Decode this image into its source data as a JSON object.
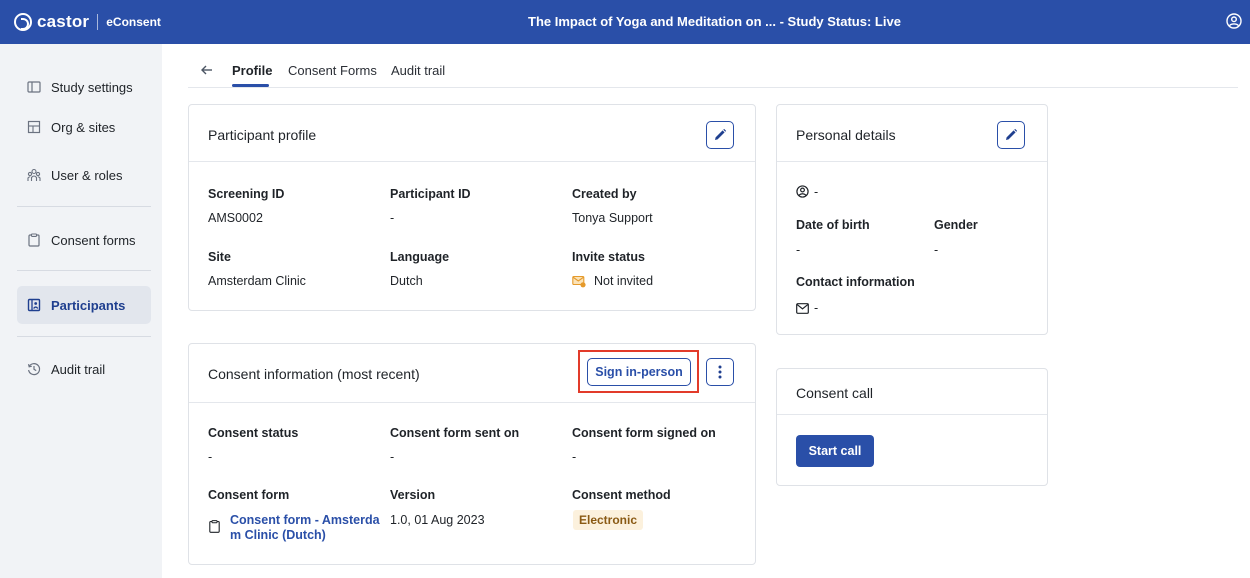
{
  "app": {
    "brand": "castor",
    "product": "eConsent",
    "title": "The Impact of Yoga and Meditation on ...  - Study Status: Live"
  },
  "sidebar": {
    "items": [
      {
        "label": "Study settings",
        "icon": "book-icon"
      },
      {
        "label": "Org & sites",
        "icon": "building-icon"
      },
      {
        "label": "User & roles",
        "icon": "users-icon"
      },
      {
        "label": "Consent forms",
        "icon": "clipboard-icon"
      },
      {
        "label": "Participants",
        "icon": "participants-icon",
        "active": true
      },
      {
        "label": "Audit trail",
        "icon": "history-icon"
      }
    ]
  },
  "tabs": [
    {
      "label": "Profile",
      "active": true
    },
    {
      "label": "Consent Forms"
    },
    {
      "label": "Audit trail"
    }
  ],
  "participant_profile": {
    "title": "Participant profile",
    "fields": {
      "screening_id": {
        "label": "Screening ID",
        "value": "AMS0002"
      },
      "participant_id": {
        "label": "Participant ID",
        "value": "-"
      },
      "created_by": {
        "label": "Created by",
        "value": "Tonya Support"
      },
      "site": {
        "label": "Site",
        "value": "Amsterdam Clinic"
      },
      "language": {
        "label": "Language",
        "value": "Dutch"
      },
      "invite_status": {
        "label": "Invite status",
        "value": "Not invited"
      }
    }
  },
  "personal_details": {
    "title": "Personal details",
    "name_value": "-",
    "date_of_birth": {
      "label": "Date of birth",
      "value": "-"
    },
    "gender": {
      "label": "Gender",
      "value": "-"
    },
    "contact": {
      "label": "Contact information",
      "value": "-"
    }
  },
  "consent_information": {
    "title": "Consent information (most recent)",
    "sign_button": "Sign in-person",
    "fields": {
      "consent_status": {
        "label": "Consent status",
        "value": "-"
      },
      "sent_on": {
        "label": "Consent form sent on",
        "value": "-"
      },
      "signed_on": {
        "label": "Consent form signed on",
        "value": "-"
      },
      "consent_form": {
        "label": "Consent form",
        "value_line1": "Consent form - Amsterda",
        "value_line2": "m Clinic (Dutch)"
      },
      "version": {
        "label": "Version",
        "value": "1.0, 01 Aug 2023"
      },
      "consent_method": {
        "label": "Consent method",
        "value": "Electronic"
      }
    }
  },
  "consent_call": {
    "title": "Consent call",
    "button": "Start call"
  },
  "colors": {
    "primary": "#2a4fa8",
    "highlight": "#e23b2a",
    "badge_bg": "#fcf1dd"
  }
}
